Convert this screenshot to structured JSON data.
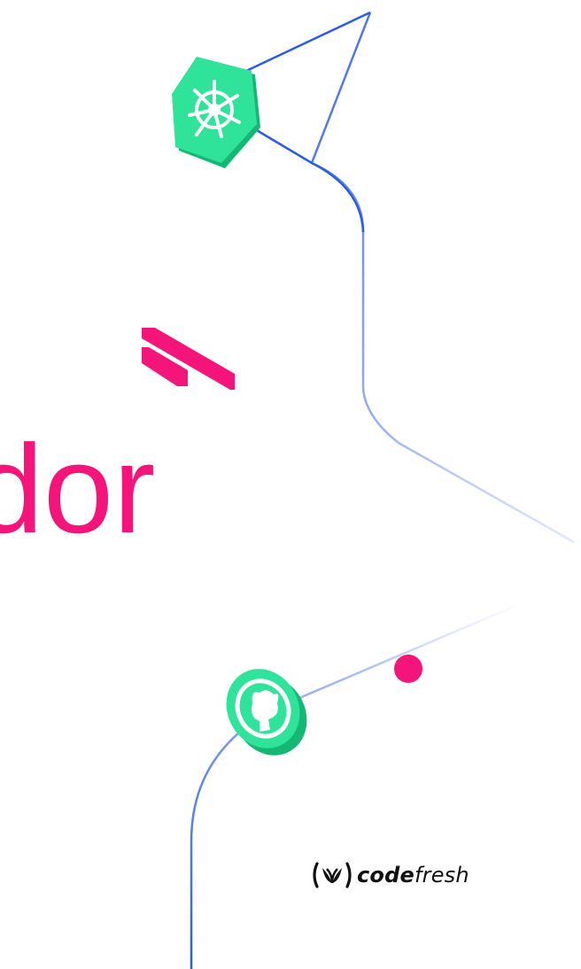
{
  "headline": {
    "text": "dor",
    "color": "#f5147a"
  },
  "brand": {
    "name_bold": "code",
    "name_light": "fresh",
    "logo_icon": "codefresh-leaf-logo-icon"
  },
  "icons": {
    "kubernetes": "kubernetes-helm-icon",
    "github": "github-octocat-icon",
    "node": "pink-node-dot-icon",
    "slashes": "pink-double-slash-icon"
  },
  "colors": {
    "accent_pink": "#f5147a",
    "accent_green": "#2fe39a",
    "green_shadow": "#14b874",
    "line_blue": "#2b5ce6",
    "text_dark": "#111111"
  }
}
